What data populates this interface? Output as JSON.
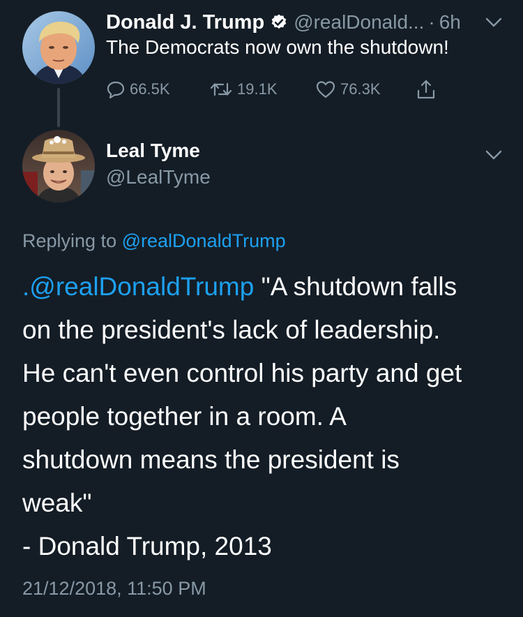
{
  "parent_tweet": {
    "name": "Donald J. Trump",
    "handle": "@realDonald...",
    "separator": "·",
    "time": "6h",
    "text": "The Democrats now own the shutdown!",
    "replies": "66.5K",
    "retweets": "19.1K",
    "likes": "76.3K"
  },
  "reply_tweet": {
    "name": "Leal Tyme",
    "handle": "@LealTyme",
    "replying_prefix": "Replying to",
    "replying_handle": "@realDonaldTrump",
    "body": {
      "mention": ".@realDonaldTrump",
      "line1_rest": " \"A shutdown falls",
      "line2": "on the president's lack of leadership.",
      "line3": "He can't even control his party and get",
      "line4": "people together in a room. A",
      "line5": "shutdown means the president is",
      "line6": "weak\"",
      "line7": "- Donald Trump, 2013"
    },
    "timestamp": "21/12/2018, 11:50 PM"
  },
  "colors": {
    "background": "#141d26",
    "secondary_text": "#8899a6",
    "link": "#1da1f2"
  }
}
